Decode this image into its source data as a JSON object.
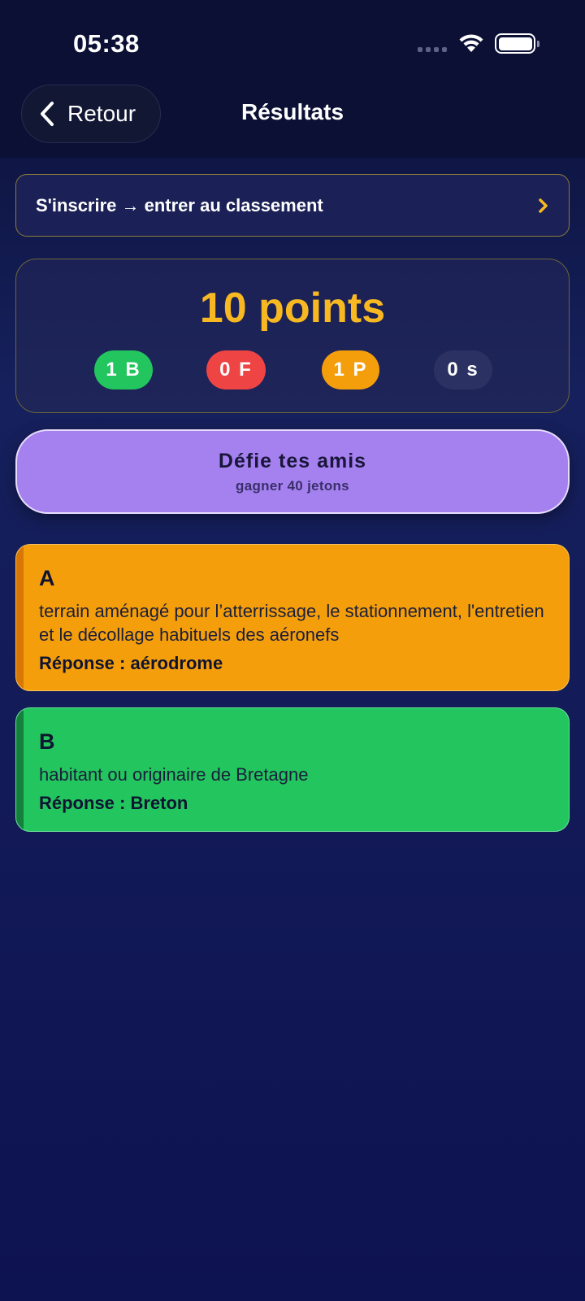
{
  "status_bar": {
    "time": "05:38"
  },
  "header": {
    "back_label": "Retour",
    "title": "Résultats"
  },
  "signup_banner": {
    "text": "S'inscrire → entrer au classement"
  },
  "score": {
    "value": "10 points",
    "pills": {
      "good": "1 B",
      "false": "0 F",
      "pass": "1 P",
      "time": "0 s"
    }
  },
  "challenge": {
    "title": "Défie tes amis",
    "subtitle": "gagner 40 jetons"
  },
  "answers": [
    {
      "letter": "A",
      "definition": "terrain aménagé pour l’atterrissage, le stationnement, l'entretien et le décollage habituels des aéronefs",
      "answer_prefix": "Réponse : ",
      "answer": "aérodrome",
      "color": "#f59e0b"
    },
    {
      "letter": "B",
      "definition": "habitant ou originaire de Bretagne",
      "answer_prefix": "Réponse : ",
      "answer": "Breton",
      "color": "#22c55e"
    }
  ],
  "colors": {
    "accent_gold": "#f8b822",
    "challenge_purple": "#a581f0",
    "good_green": "#22c55e",
    "false_red": "#ef4444",
    "pass_orange": "#f59e0b"
  }
}
